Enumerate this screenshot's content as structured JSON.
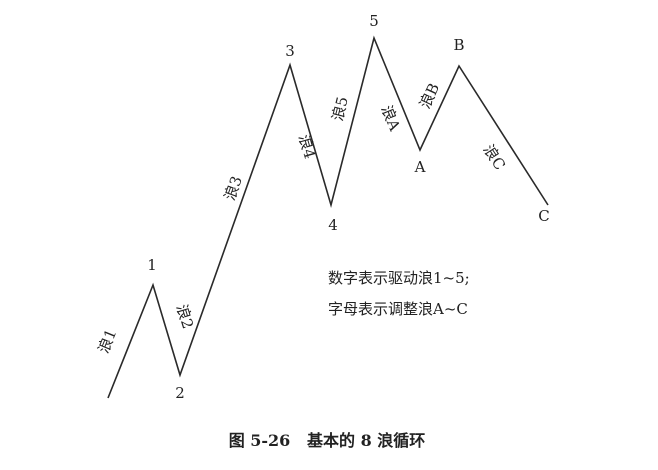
{
  "diagram": {
    "points": [
      "1",
      "2",
      "3",
      "4",
      "5",
      "A",
      "B",
      "C"
    ],
    "wave_labels": [
      "浪1",
      "浪2",
      "浪3",
      "浪4",
      "浪5",
      "浪A",
      "浪B",
      "浪C"
    ],
    "note_lines": [
      "数字表示驱动浪1~5;",
      "字母表示调整浪A~C"
    ],
    "caption": "图 5-26   基本的 8 浪循环"
  }
}
